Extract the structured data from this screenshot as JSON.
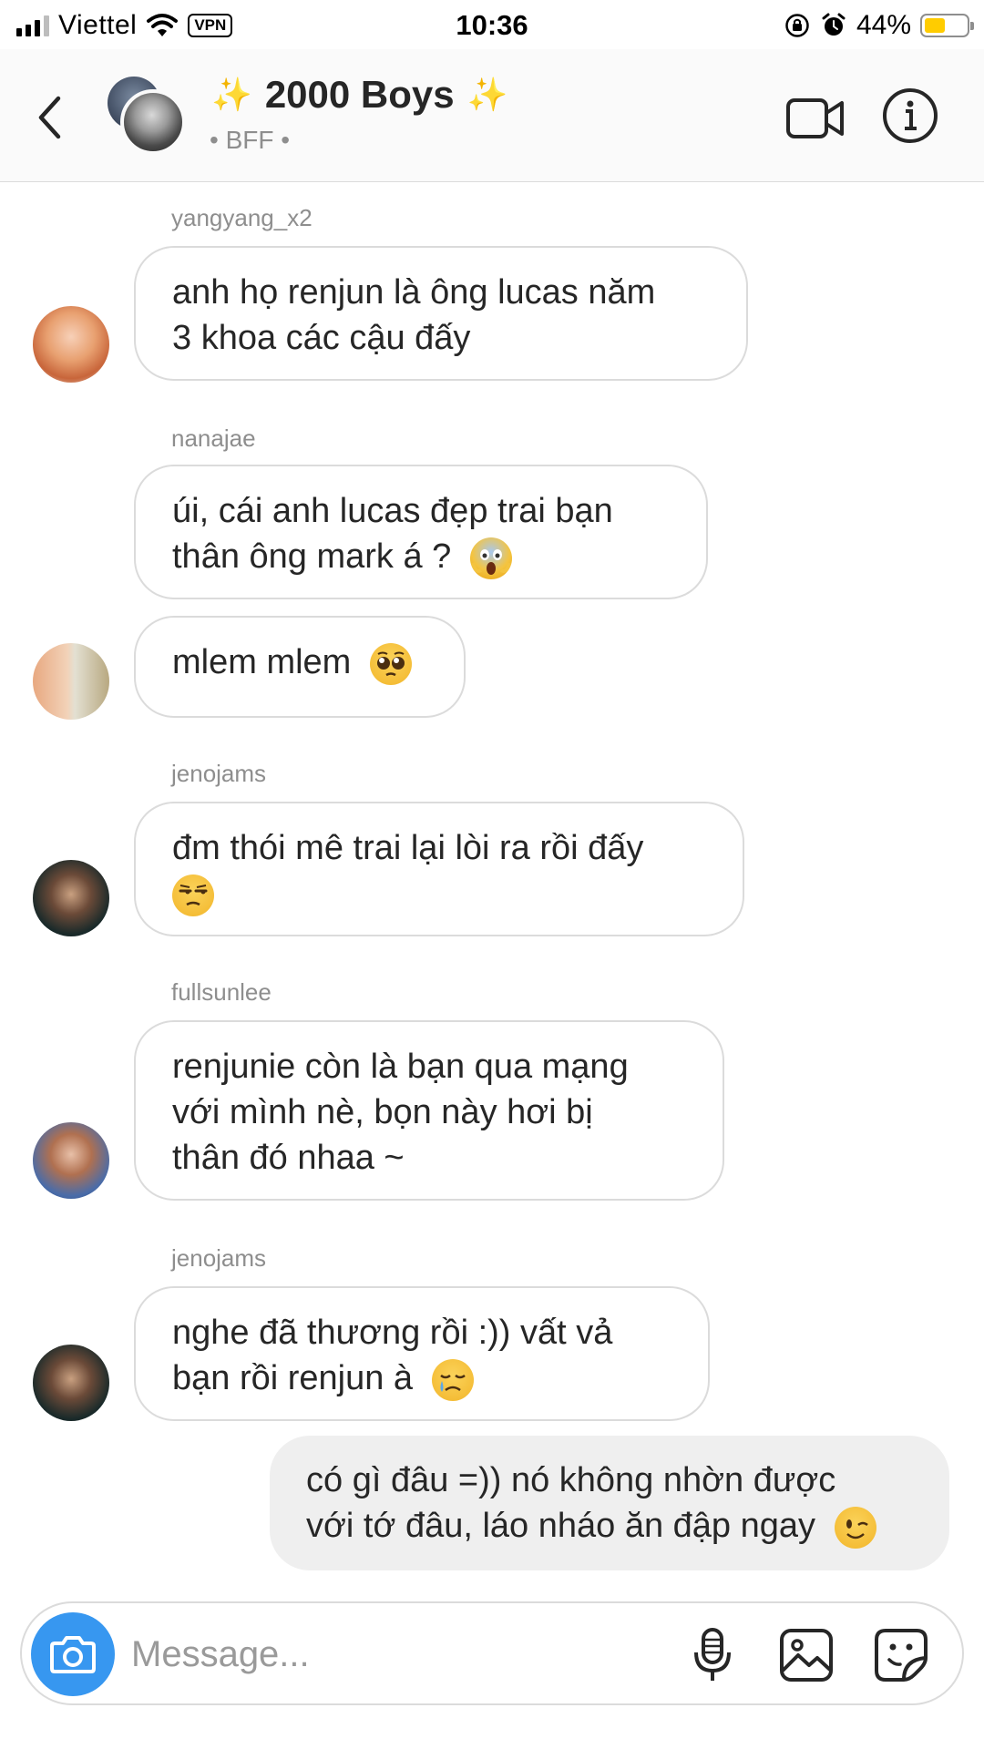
{
  "status_bar": {
    "carrier": "Viettel",
    "vpn": "VPN",
    "time": "10:36",
    "battery_percent": "44%",
    "battery_level": 0.44,
    "icons": [
      "signal-icon",
      "wifi-icon",
      "rotation-lock-icon",
      "alarm-icon",
      "battery-icon"
    ]
  },
  "header": {
    "title": "2000 Boys",
    "title_decoration": "✨",
    "subtitle": "• BFF •",
    "icons": [
      "back-icon",
      "video-call-icon",
      "info-icon"
    ]
  },
  "messages": [
    {
      "sender": "yangyang_x2",
      "lines": [
        "anh họ renjun là ông lucas năm",
        "3 khoa các cậu đấy"
      ],
      "emoji": ""
    },
    {
      "sender": "nanajae",
      "lines": [
        "úi, cái anh lucas đẹp trai bạn",
        "thân ông mark á ?"
      ],
      "emoji": "face-screaming-in-fear"
    },
    {
      "sender": "",
      "lines": [
        "mlem mlem"
      ],
      "emoji": "pleading-face"
    },
    {
      "sender": "jenojams",
      "lines": [
        "đm thói mê trai lại lòi ra rồi đấy",
        ""
      ],
      "emoji": "unamused-face"
    },
    {
      "sender": "fullsunlee",
      "lines": [
        "renjunie còn là bạn qua mạng",
        "với mình nè, bọn này hơi bị",
        "thân đó nhaa ~"
      ],
      "emoji": ""
    },
    {
      "sender": "jenojams",
      "lines": [
        "nghe đã thương rồi :)) vất vả",
        "bạn rồi renjun à"
      ],
      "emoji": "crying-face"
    },
    {
      "sender": "me",
      "lines": [
        "có gì đâu =)) nó không nhờn được",
        "với tớ đâu, láo nháo ăn đập ngay"
      ],
      "emoji": "winking-face"
    }
  ],
  "composer": {
    "placeholder": "Message...",
    "icons": [
      "camera-icon",
      "microphone-icon",
      "gallery-icon",
      "sticker-icon"
    ]
  },
  "colors": {
    "accent": "#3797f0",
    "bubble_border": "#dbdbdb",
    "my_bubble": "#efefef",
    "secondary_text": "#8e8e8e",
    "battery": "#ffcc00"
  }
}
